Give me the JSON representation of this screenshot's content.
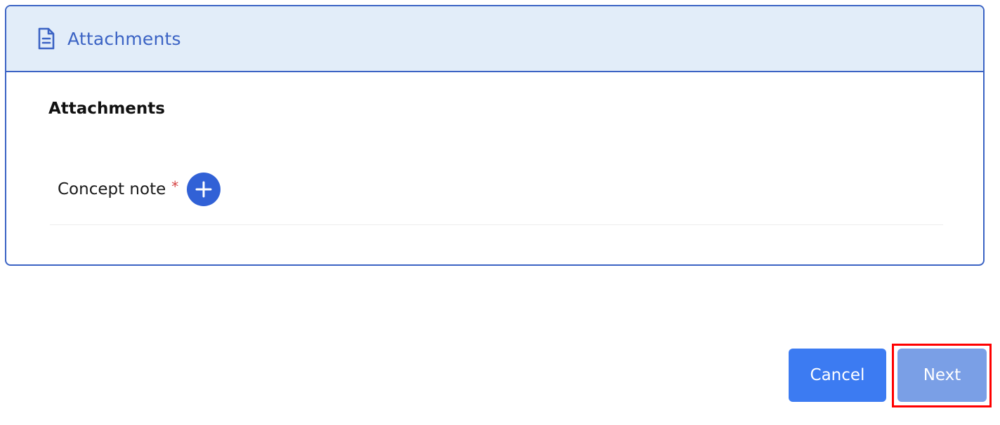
{
  "panel": {
    "header_title": "Attachments",
    "header_icon": "document-icon",
    "section_title": "Attachments",
    "fields": [
      {
        "label": "Concept note",
        "required_marker": "*",
        "action_icon": "plus-icon"
      }
    ]
  },
  "footer": {
    "cancel_label": "Cancel",
    "next_label": "Next"
  },
  "colors": {
    "accent": "#3b63c4",
    "header_background": "#e2edf9",
    "cancel_button": "#3c7bf2",
    "next_button": "#7a9fe6",
    "required": "#d64545",
    "highlight": "#ff0000"
  }
}
